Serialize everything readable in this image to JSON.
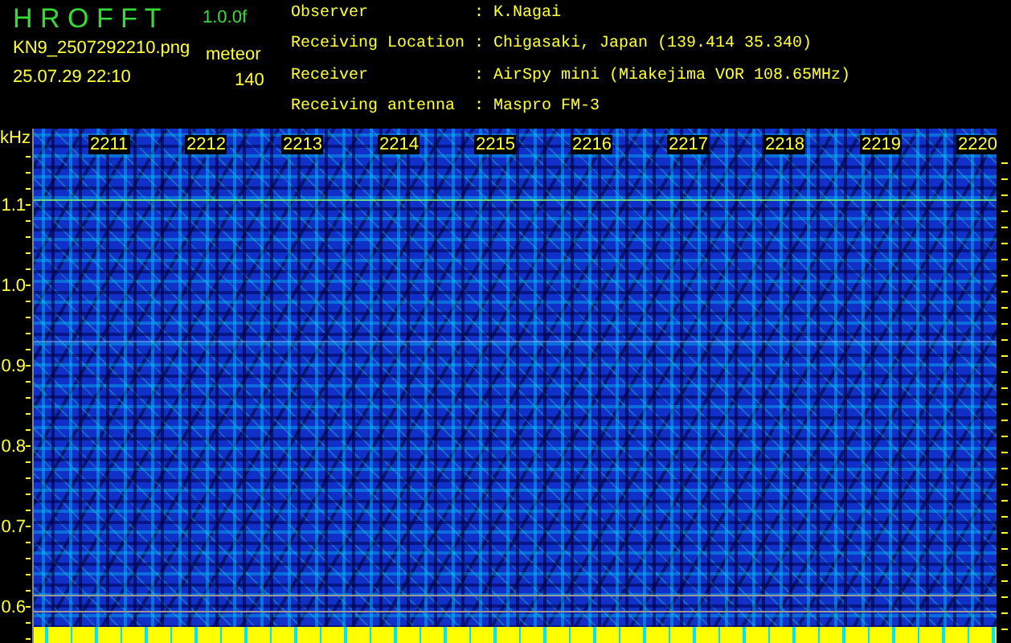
{
  "header": {
    "title": "H R O F F T",
    "version": "1.0.0f",
    "filename": "KN9_2507292210.png",
    "timestamp": "25.07.29 22:10",
    "mode": "meteor",
    "count": "140"
  },
  "info": [
    {
      "label": "Observer",
      "separator": ":",
      "value": "K.Nagai"
    },
    {
      "label": "Receiving Location",
      "separator": ":",
      "value": "Chigasaki, Japan (139.414 35.340)"
    },
    {
      "label": "Receiver",
      "separator": ":",
      "value": "AirSpy mini (Miakejima VOR 108.65MHz)"
    },
    {
      "label": "Receiving antenna",
      "separator": ":",
      "value": "Maspro FM-3"
    }
  ],
  "plot": {
    "y_unit": "kHz",
    "y_labels": [
      "1.1",
      "1.0",
      "0.9",
      "0.8",
      "0.7",
      "0.6"
    ],
    "time_labels": [
      "2211",
      "2212",
      "2213",
      "2214",
      "2215",
      "2216",
      "2217",
      "2218",
      "2219",
      "2220"
    ]
  }
}
